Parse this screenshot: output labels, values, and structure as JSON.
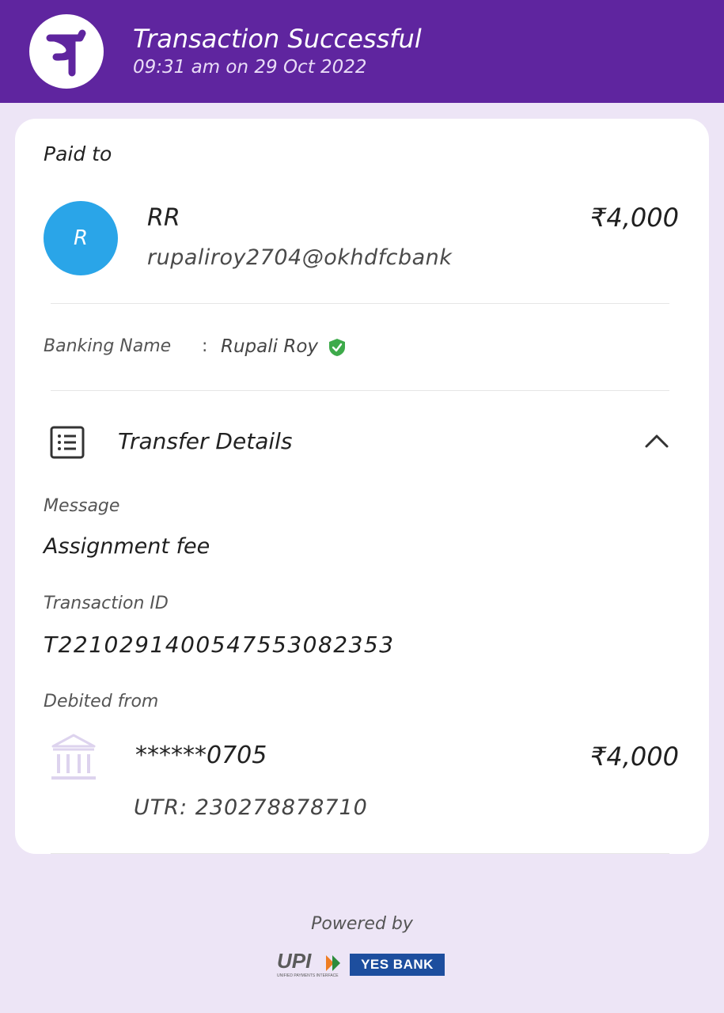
{
  "header": {
    "title": "Transaction Successful",
    "timestamp": "09:31 am on 29 Oct 2022",
    "logo_glyph": "पे",
    "bg_color": "#5f259f"
  },
  "payment": {
    "paid_to_label": "Paid to",
    "payee_initial": "R",
    "payee_name": "RR",
    "payee_upi": "rupaliroy2704@okhdfcbank",
    "amount": "₹4,000",
    "avatar_color": "#2aa5e8"
  },
  "banking": {
    "label": "Banking Name",
    "separator": ":",
    "value": "Rupali Roy",
    "verified_icon": "shield-check-icon"
  },
  "transfer_details": {
    "title": "Transfer Details",
    "icon": "receipt-list-icon",
    "toggle_icon": "chevron-up-icon",
    "message_label": "Message",
    "message_value": "Assignment fee",
    "transaction_id_label": "Transaction ID",
    "transaction_id_value": "T2210291400547553082353",
    "debited_from_label": "Debited from",
    "account_masked": "******0705",
    "debited_amount": "₹4,000",
    "utr": "UTR: 230278878710"
  },
  "footer": {
    "powered_by": "Powered by",
    "upi_logo_text": "UPI",
    "upi_tagline": "UNIFIED PAYMENTS INTERFACE",
    "bank_logo_text": "YES BANK"
  }
}
